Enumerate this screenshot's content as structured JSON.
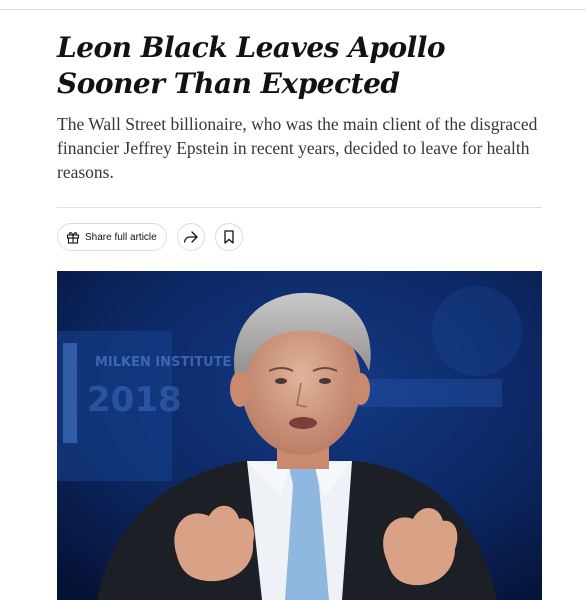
{
  "article": {
    "headline": "Leon Black Leaves Apollo Sooner Than Expected",
    "summary": "The Wall Street billionaire, who was the main client of the disgraced financier Jeffrey Epstein in recent years, decided to leave for health reasons."
  },
  "actions": {
    "share_label": "Share full article",
    "share_icon": "gift-icon",
    "forward_icon": "share-arrow-icon",
    "bookmark_icon": "bookmark-icon"
  },
  "photo": {
    "backdrop_text": "MILKEN INSTITUTE",
    "backdrop_year": "2018",
    "colors": {
      "backdrop": "#0d1f4f",
      "suit": "#1c1f26",
      "tie": "#8fb8e0",
      "shirt": "#eef2f6"
    }
  }
}
